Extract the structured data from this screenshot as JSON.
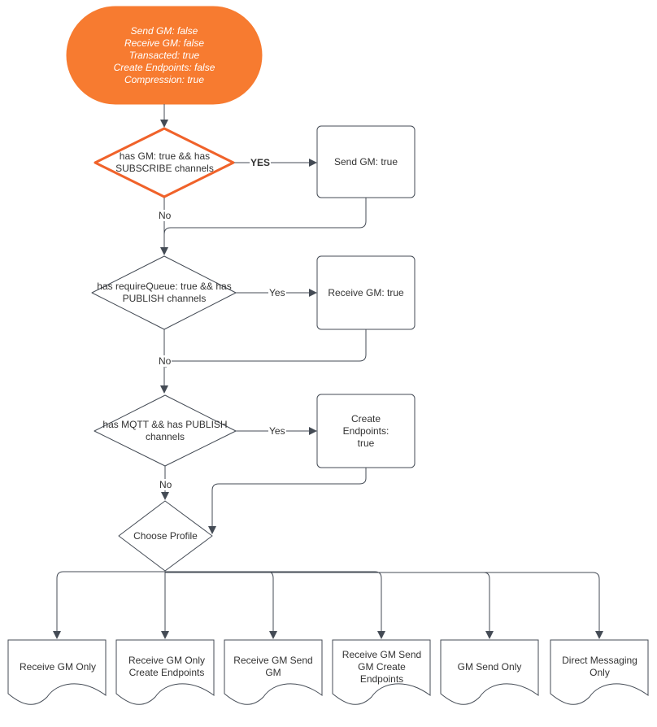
{
  "diagram": {
    "start": {
      "lines": [
        "Send GM: false",
        "Receive GM: false",
        "Transacted: true",
        "Create Endpoints: false",
        "Compression: true"
      ],
      "fill": "#f77b30"
    },
    "decisions": [
      {
        "id": "d1",
        "label": "has GM: true && has SUBSCRIBE channels",
        "yes_label": "YES",
        "no_label": "No",
        "highlight": "#f0622a"
      },
      {
        "id": "d2",
        "label": "has requireQueue: true && has PUBLISH channels",
        "yes_label": "Yes",
        "no_label": "No"
      },
      {
        "id": "d3",
        "label": "has MQTT && has PUBLISH channels",
        "yes_label": "Yes",
        "no_label": "No"
      }
    ],
    "processes": [
      {
        "id": "p1",
        "label": "Send GM: true"
      },
      {
        "id": "p2",
        "label": "Receive GM: true"
      },
      {
        "id": "p3",
        "label": "Create Endpoints: true"
      }
    ],
    "choose": {
      "label": "Choose Profile"
    },
    "profiles": [
      {
        "label": "Receive GM Only"
      },
      {
        "label": "Receive GM Only Create Endpoints"
      },
      {
        "label": "Receive GM Send GM"
      },
      {
        "label": "Receive GM Send GM Create Endpoints"
      },
      {
        "label": "GM Send Only"
      },
      {
        "label": "Direct Messaging Only"
      }
    ],
    "colors": {
      "stroke": "#444b55",
      "accent": "#f77b30"
    }
  }
}
